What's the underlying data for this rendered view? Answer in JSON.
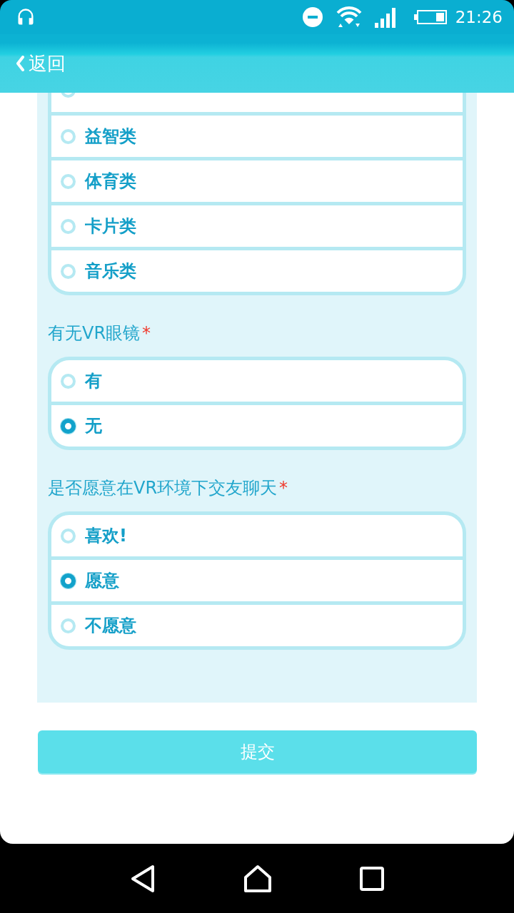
{
  "status_bar": {
    "time": "21:26"
  },
  "header": {
    "back_label": "返回"
  },
  "questions": [
    {
      "cut_off": true,
      "options": [
        {
          "selected": false
        },
        {
          "label": "益智类",
          "selected": false
        },
        {
          "label": "体育类",
          "selected": false
        },
        {
          "label": "卡片类",
          "selected": false
        },
        {
          "label": "音乐类",
          "selected": false
        }
      ]
    },
    {
      "cut_off": false,
      "title": "有无VR眼镜",
      "required_mark": "*",
      "options": [
        {
          "label": "有",
          "selected": false
        },
        {
          "label": "无",
          "selected": true
        }
      ]
    },
    {
      "cut_off": false,
      "title": "是否愿意在VR环境下交友聊天",
      "required_mark": "*",
      "options": [
        {
          "label": "喜欢!",
          "selected": false
        },
        {
          "label": "愿意",
          "selected": true
        },
        {
          "label": "不愿意",
          "selected": false
        }
      ]
    }
  ],
  "submit": {
    "label": "提交"
  }
}
